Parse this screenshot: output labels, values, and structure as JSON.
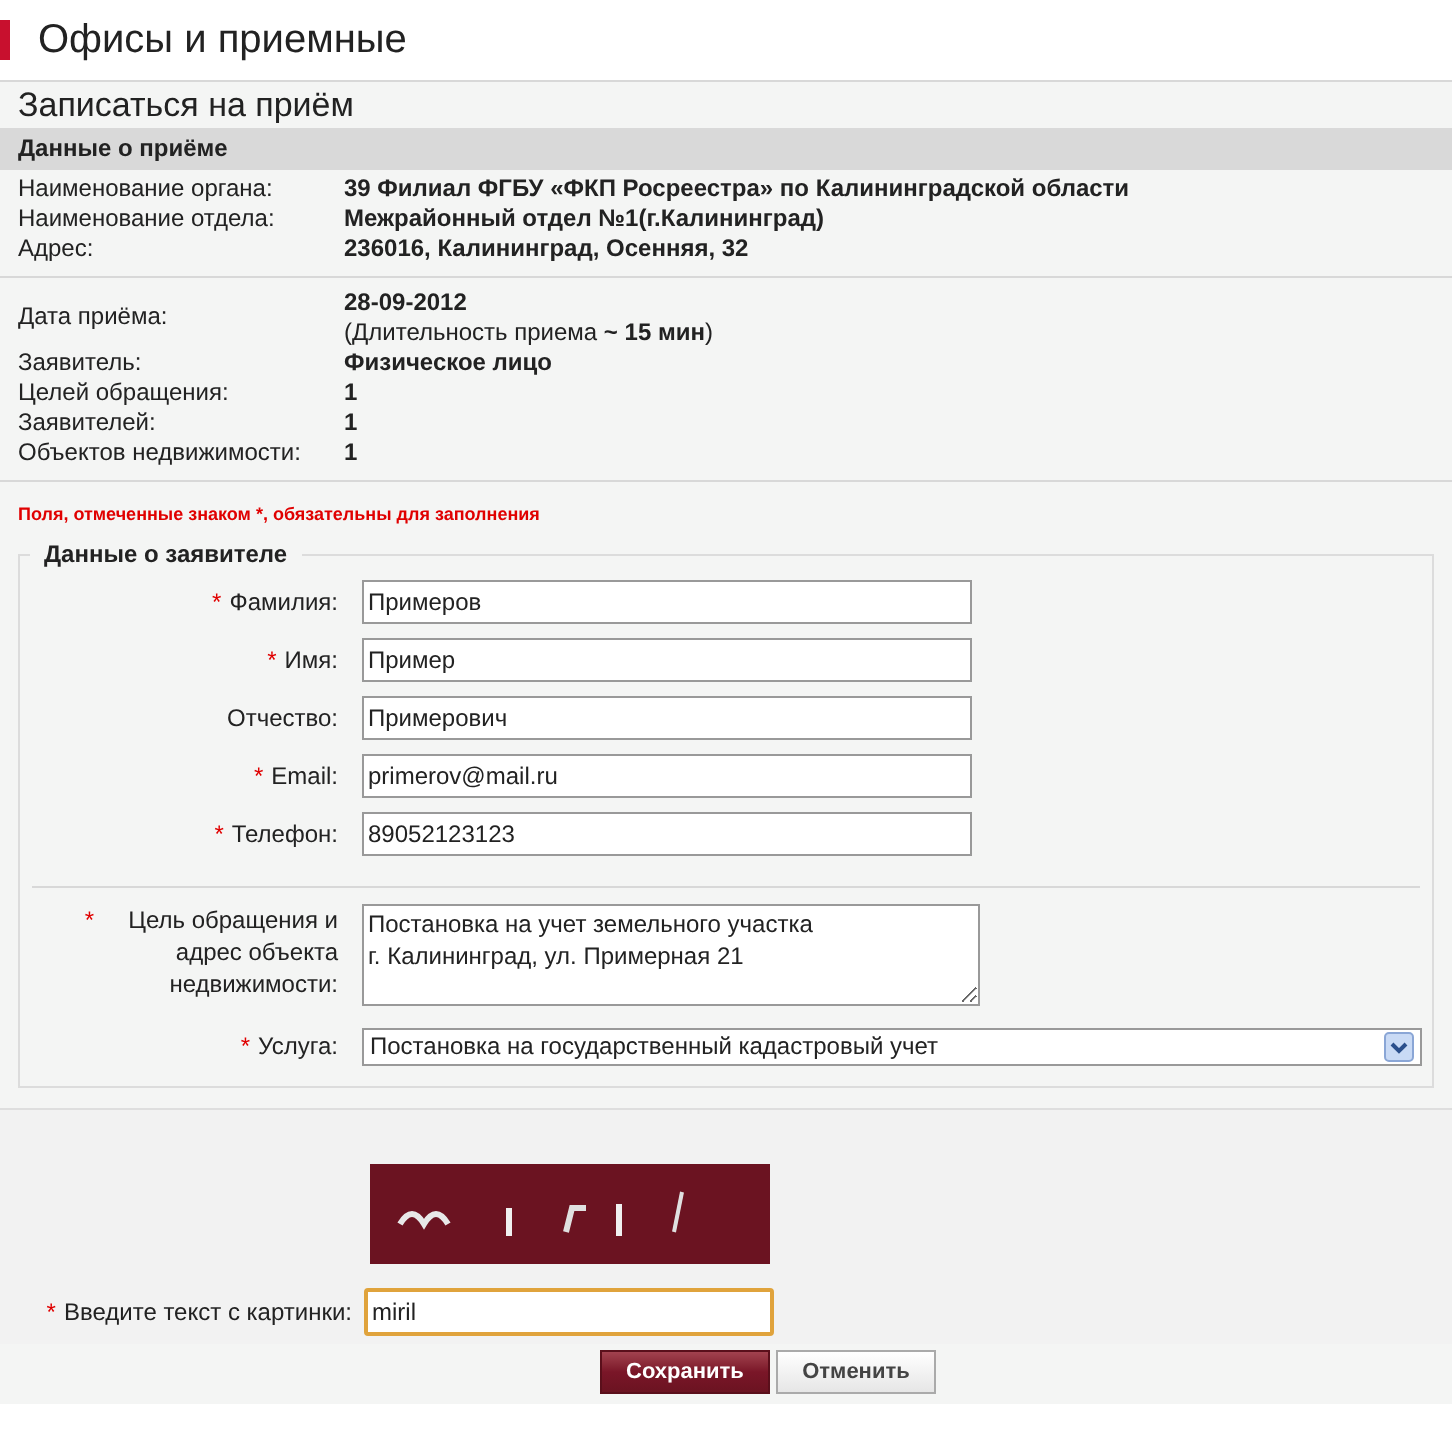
{
  "page_title": "Офисы и приемные",
  "section_title": "Записаться на приём",
  "appointment": {
    "header": "Данные о приёме",
    "group_1": [
      {
        "label": "Наименование органа:",
        "value": "39 Филиал ФГБУ «ФКП Росреестра» по Калининградской области"
      },
      {
        "label": "Наименование отдела:",
        "value": "Межрайонный отдел №1(г.Калининград)"
      },
      {
        "label": "Адрес:",
        "value": "236016, Калининград, Осенняя, 32"
      }
    ],
    "date": {
      "label": "Дата приёма:",
      "value": "28-09-2012",
      "duration": "(Длительность приема **~ 15 мин**)"
    },
    "group_2": [
      {
        "label": "Заявитель:",
        "value": "Физическое лицо"
      },
      {
        "label": "Целей обращения:",
        "value": "1"
      },
      {
        "label": "Заявителей:",
        "value": "1"
      },
      {
        "label": "Объектов недвижимости:",
        "value": "1"
      }
    ]
  },
  "required_note": "Поля, отмеченные знаком *, обязательны для заполнения",
  "applicant": {
    "legend": "Данные о заявителе",
    "fields": [
      {
        "mark": "*",
        "label": "Фамилия:",
        "value": "Примеров"
      },
      {
        "mark": "*",
        "label": "Имя:",
        "value": "Пример"
      },
      {
        "label": "Отчество:",
        "value": "Примерович"
      },
      {
        "mark": "*",
        "label": "Email:",
        "value": "primerov@mail.ru"
      },
      {
        "mark": "*",
        "label": "Телефон:",
        "value": "89052123123"
      }
    ],
    "purpose": {
      "mark": "*",
      "label": "Цель обращения и адрес объекта недвижимости:",
      "value": "Постановка на учет земельного участка\nг. Калининград, ул. Примерная 21"
    },
    "service": {
      "mark": "*",
      "label": "Услуга:",
      "value": "Постановка на государственный кадастровый учет"
    }
  },
  "captcha": {
    "mark": "*",
    "label": "Введите текст с картинки:",
    "value": "miril",
    "focused": true
  },
  "buttons": [
    {
      "label": "Сохранить",
      "kind": "primary"
    },
    {
      "label": "Отменить",
      "kind": "secondary"
    }
  ]
}
